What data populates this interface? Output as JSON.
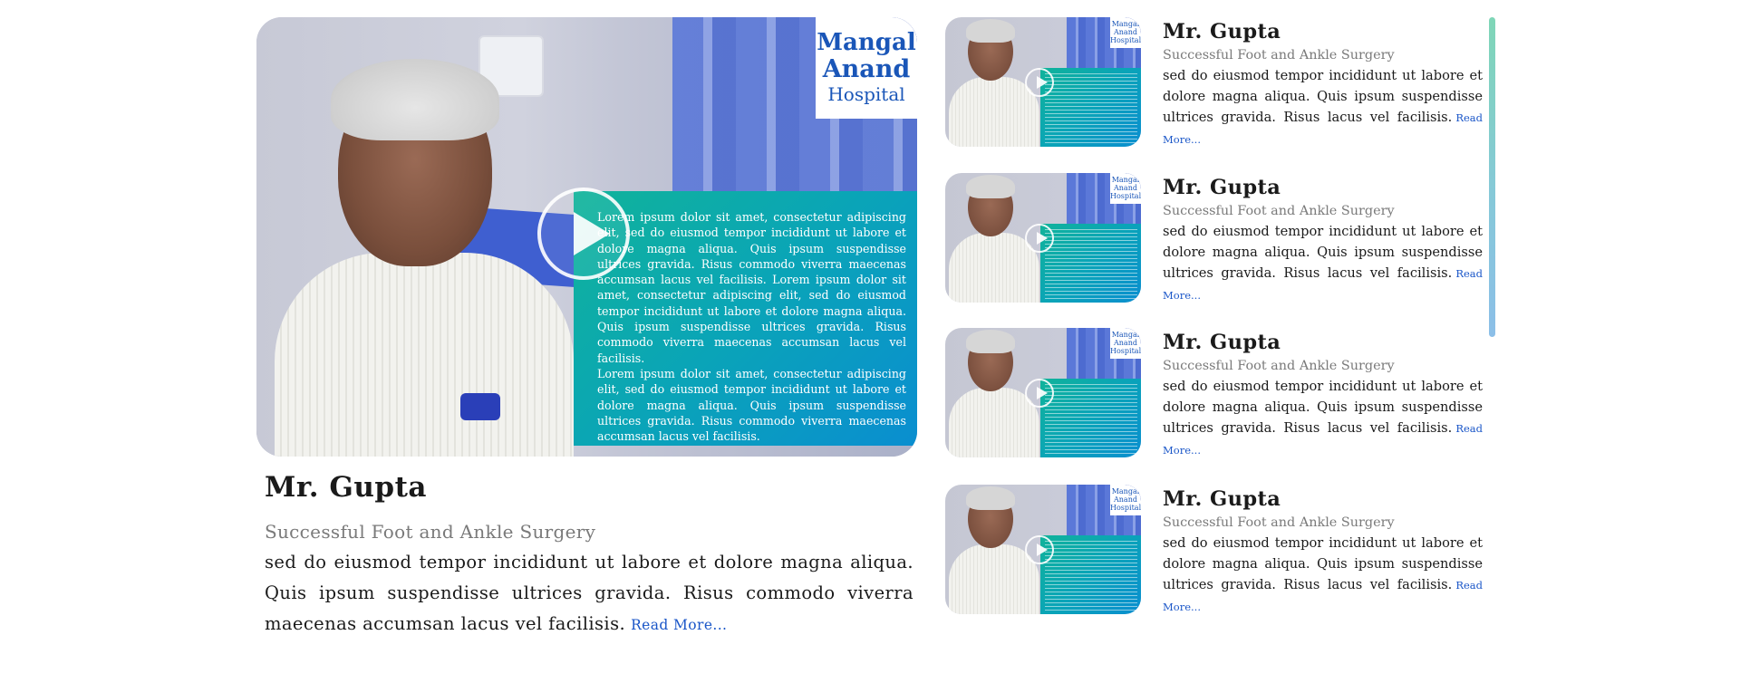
{
  "featured": {
    "video": {
      "overlay_paragraphs": [
        "Lorem ipsum dolor sit amet, consectetur adipiscing elit, sed do eiusmod tempor incididunt ut labore et dolore magna aliqua. Quis ipsum suspendisse ultrices gravida. Risus commodo viverra maecenas accumsan lacus vel facilisis. Lorem ipsum dolor sit amet, consectetur adipiscing elit, sed do eiusmod tempor incididunt ut labore et dolore magna aliqua. Quis ipsum suspendisse ultrices gravida. Risus commodo viverra maecenas accumsan lacus vel facilisis.",
        "Lorem ipsum dolor sit amet, consectetur adipiscing elit, sed do eiusmod tempor incididunt ut labore et dolore magna aliqua. Quis ipsum suspendisse ultrices gravida. Risus commodo viverra maecenas accumsan lacus vel facilisis."
      ],
      "logo": {
        "line1": "Mangal",
        "line2": "Anand",
        "line3": "Hospital"
      }
    },
    "name": "Mr. Gupta",
    "subtitle": "Successful Foot and Ankle Surgery",
    "description": "sed do eiusmod tempor incididunt ut labore et dolore magna aliqua. Quis ipsum suspendisse ultrices gravida. Risus commodo viverra maecenas accumsan lacus vel facilisis.",
    "read_more": "Read More..."
  },
  "list": {
    "items": [
      {
        "name": "Mr. Gupta",
        "subtitle": "Successful Foot and Ankle Surgery",
        "description": "sed do eiusmod tempor incididunt ut labore et dolore magna aliqua. Quis ipsum suspendisse ultrices gravida. Risus  lacus vel facilisis.",
        "read_more": "Read More...",
        "logo": "Mangal Anand Hospital"
      },
      {
        "name": "Mr. Gupta",
        "subtitle": "Successful Foot and Ankle Surgery",
        "description": "sed do eiusmod tempor incididunt ut labore et dolore magna aliqua. Quis ipsum suspendisse ultrices gravida. Risus  lacus vel facilisis.",
        "read_more": "Read More...",
        "logo": "Mangal Anand Hospital"
      },
      {
        "name": "Mr. Gupta",
        "subtitle": "Successful Foot and Ankle Surgery",
        "description": "sed do eiusmod tempor incididunt ut labore et dolore magna aliqua. Quis ipsum suspendisse ultrices gravida. Risus  lacus vel facilisis.",
        "read_more": "Read More...",
        "logo": "Mangal Anand Hospital"
      },
      {
        "name": "Mr. Gupta",
        "subtitle": "Successful Foot and Ankle Surgery",
        "description": "sed do eiusmod tempor incididunt ut labore et dolore magna aliqua. Quis ipsum suspendisse ultrices gravida. Risus  lacus vel facilisis.",
        "read_more": "Read More...",
        "logo": "Mangal Anand Hospital"
      }
    ]
  },
  "icons": {
    "play": "play-icon"
  },
  "colors": {
    "accent_link": "#1a56c8",
    "overlay_start": "#10b39a",
    "overlay_end": "#0a8ed0",
    "logo_blue": "#1a56b8"
  }
}
